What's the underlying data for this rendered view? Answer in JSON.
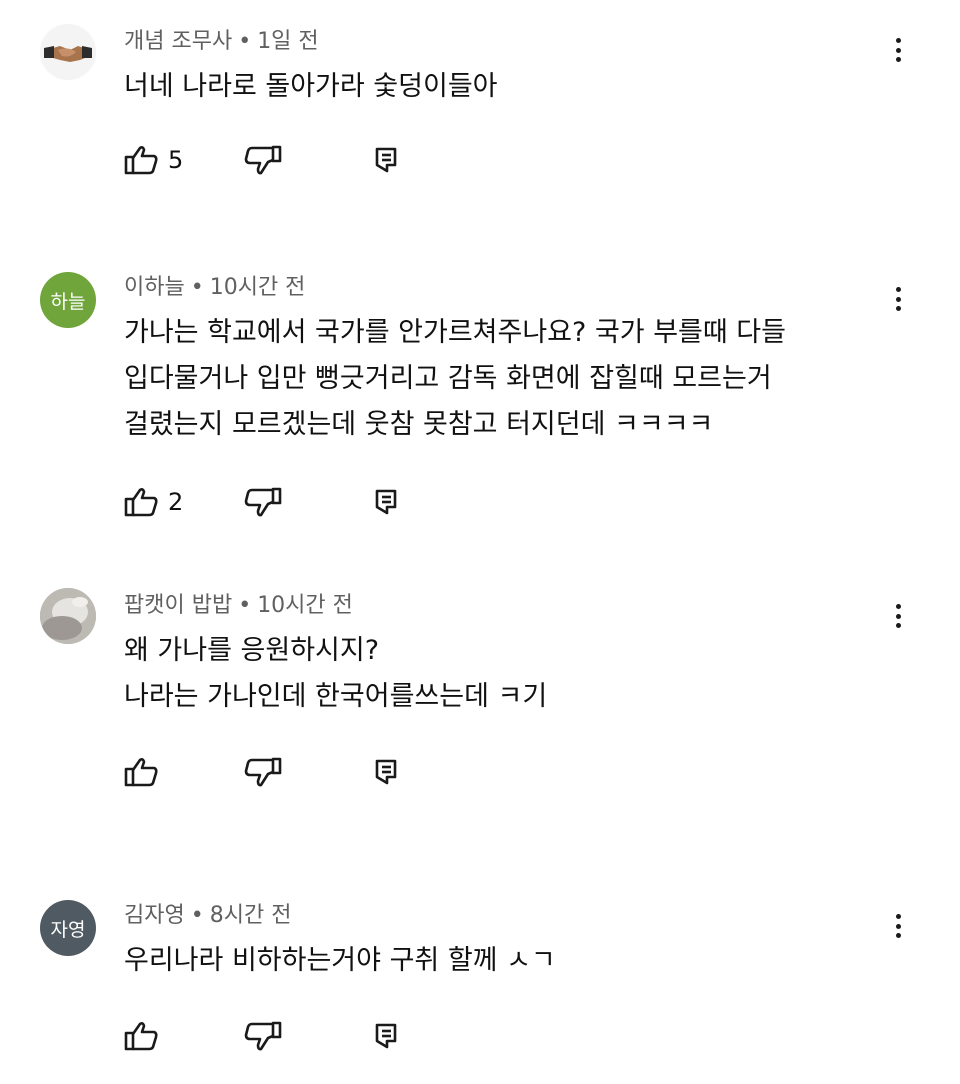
{
  "comments": [
    {
      "author": "개념 조무사",
      "time": "1일 전",
      "lines": "너네 나라로 돌아가라 숯덩이들아",
      "likes": "5",
      "avatar_initials": "",
      "avatar_icon": "handshake-icon"
    },
    {
      "author": "이하늘",
      "time": "10시간 전",
      "lines": "가나는 학교에서 국가를 안가르쳐주나요? 국가 부를때 다들\n입다물거나 입만 뻥긋거리고 감독 화면에 잡힐때 모르는거\n걸렸는지 모르겠는데 웃참 못참고 터지던데 ㅋㅋㅋㅋ",
      "likes": "2",
      "avatar_initials": "하늘",
      "avatar_color": "#6fa53a"
    },
    {
      "author": "팝캣이 밥밥",
      "time": "10시간 전",
      "lines": "왜 가나를 응원하시지?\n나라는 가나인데 한국어를쓰는데 ㅋ기",
      "likes": "",
      "avatar_initials": "",
      "avatar_icon": "cat-photo-icon"
    },
    {
      "author": "김자영",
      "time": "8시간 전",
      "lines": "우리나라 비하하는거야 구취 할께 ㅅㄱ",
      "likes": "",
      "avatar_initials": "자영",
      "avatar_color": "#4f5a63"
    }
  ],
  "meta_separator": "•",
  "colors": {
    "meta_text": "#606060",
    "body_text": "#111111",
    "icon": "#1a1a1a"
  },
  "icons": {
    "like": "thumbs-up-icon",
    "dislike": "thumbs-down-icon",
    "reply": "reply-icon",
    "more": "more-vertical-icon"
  }
}
